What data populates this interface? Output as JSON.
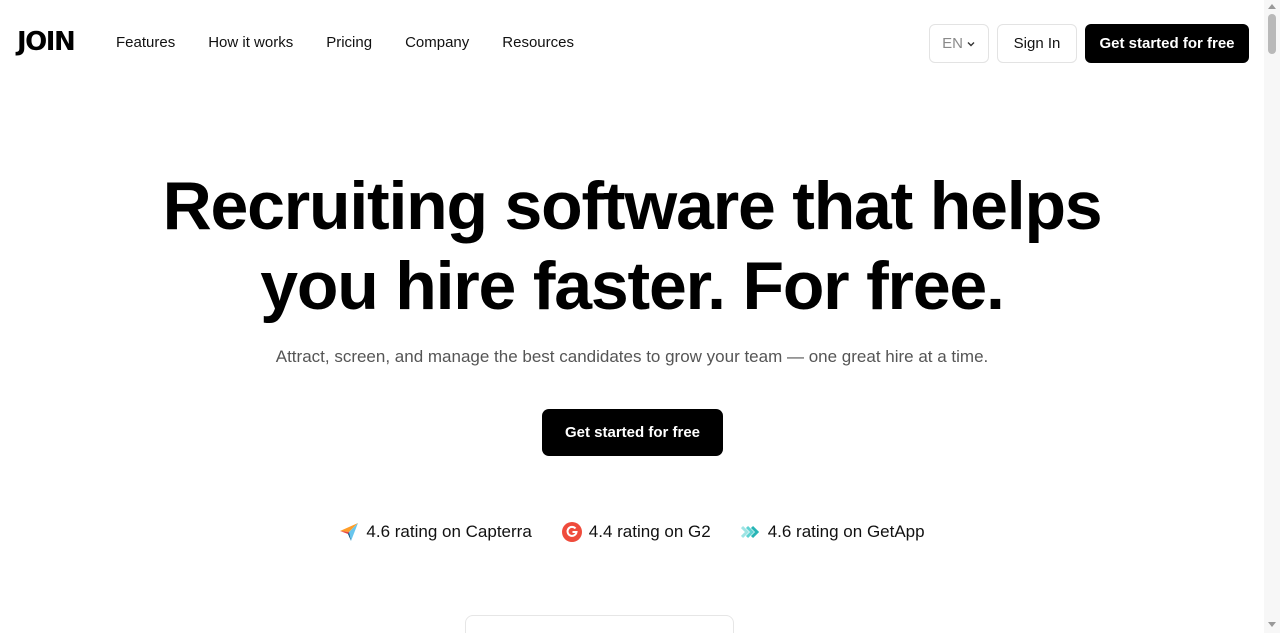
{
  "header": {
    "logo": "JOIN",
    "nav": [
      "Features",
      "How it works",
      "Pricing",
      "Company",
      "Resources"
    ],
    "language": "EN",
    "sign_in": "Sign In",
    "cta": "Get started for free"
  },
  "hero": {
    "title_line1": "Recruiting software that helps",
    "title_line2": "you hire faster. For free.",
    "subtitle": "Attract, screen, and manage the best candidates to grow your team — one great hire at a time.",
    "cta": "Get started for free"
  },
  "ratings": [
    {
      "icon": "capterra-icon",
      "label": "4.6 rating on Capterra"
    },
    {
      "icon": "g2-icon",
      "label": "4.4 rating on G2"
    },
    {
      "icon": "getapp-icon",
      "label": "4.6 rating on GetApp"
    }
  ],
  "colors": {
    "primary": "#000000",
    "background": "#ffffff",
    "muted_text": "#555555",
    "g2": "#ef4b3c",
    "getapp": "#37c5c5"
  }
}
